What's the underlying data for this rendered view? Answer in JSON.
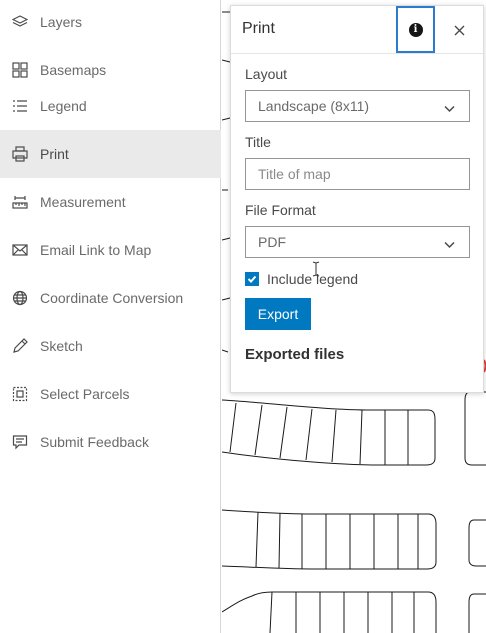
{
  "sidebar": {
    "items": [
      {
        "label": "Layers",
        "icon": "layers-icon"
      },
      {
        "label": "Basemaps",
        "icon": "basemap-grid-icon"
      },
      {
        "label": "Legend",
        "icon": "legend-list-icon"
      },
      {
        "label": "Print",
        "icon": "printer-icon",
        "active": true
      },
      {
        "label": "Measurement",
        "icon": "measure-icon"
      },
      {
        "label": "Email Link to Map",
        "icon": "envelope-icon"
      },
      {
        "label": "Coordinate Conversion",
        "icon": "globe-icon"
      },
      {
        "label": "Sketch",
        "icon": "pencil-icon"
      },
      {
        "label": "Select Parcels",
        "icon": "select-parcels-icon"
      },
      {
        "label": "Submit Feedback",
        "icon": "feedback-icon"
      }
    ]
  },
  "print_panel": {
    "title": "Print",
    "info_icon": "info-icon",
    "close_icon": "close-icon",
    "layout": {
      "label": "Layout",
      "value": "Landscape (8x11)"
    },
    "map_title": {
      "label": "Title",
      "placeholder": "Title of map",
      "value": ""
    },
    "file_format": {
      "label": "File Format",
      "value": "PDF"
    },
    "include_legend": {
      "label": "Include legend",
      "checked": true
    },
    "export_label": "Export",
    "exported_files_title": "Exported files"
  },
  "colors": {
    "accent": "#0079c1",
    "focus_outline": "#2b7bd0",
    "sidebar_active": "#eaeaea"
  }
}
